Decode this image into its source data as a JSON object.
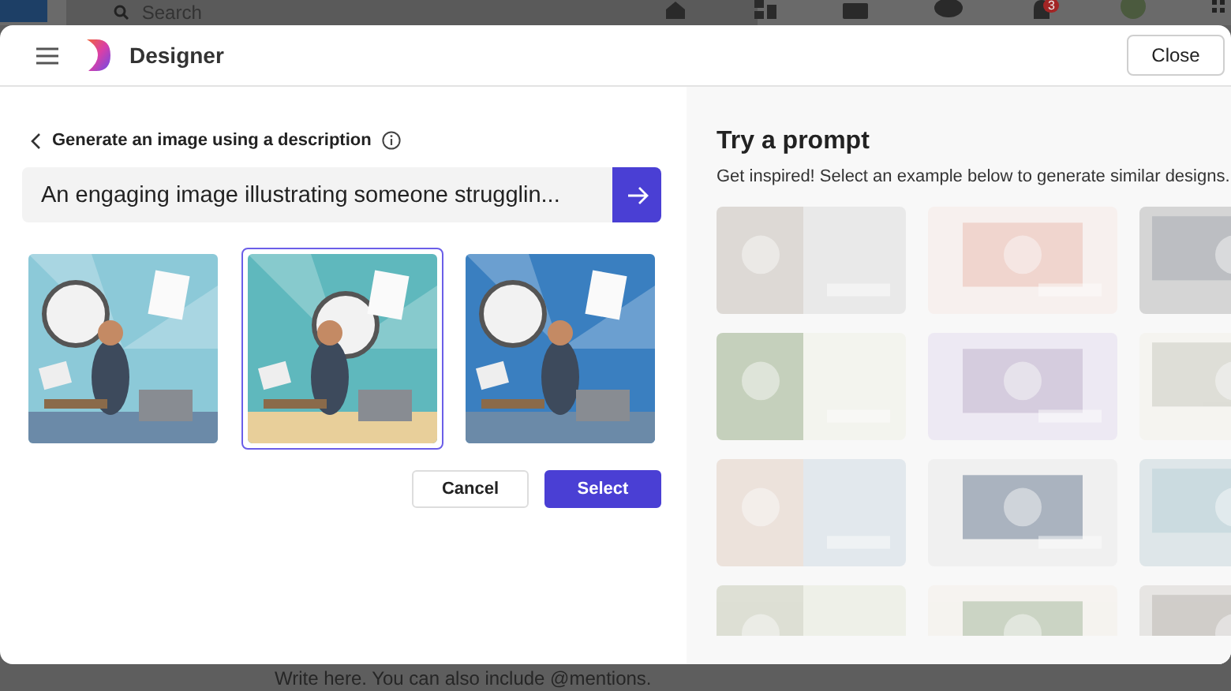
{
  "background": {
    "search": {
      "placeholder": "Search"
    },
    "notification_badge": "3",
    "composer": {
      "placeholder": "Write here. You can also include @mentions."
    }
  },
  "header": {
    "title": "Designer",
    "close_button": "Close"
  },
  "generator": {
    "back_label": "Generate an image using a description",
    "prompt": "An engaging image illustrating someone strugglin...",
    "results": [
      {
        "kind": "picture",
        "selected": false
      },
      {
        "kind": "picture",
        "selected": true
      },
      {
        "kind": "picture",
        "selected": false
      }
    ],
    "buttons": [
      {
        "label": "Cancel",
        "kind": "secondary"
      },
      {
        "label": "Select",
        "kind": "primary"
      }
    ]
  },
  "prompts_panel": {
    "title": "Try a prompt",
    "subtitle": "Get inspired! Select an example below to generate similar designs.",
    "examples": [
      {
        "kind": "picture"
      },
      {
        "kind": "picture"
      },
      {
        "kind": "picture"
      },
      {
        "kind": "picture"
      },
      {
        "kind": "picture"
      },
      {
        "kind": "picture"
      },
      {
        "kind": "picture"
      },
      {
        "kind": "picture"
      },
      {
        "kind": "picture"
      },
      {
        "kind": "picture"
      },
      {
        "kind": "picture"
      },
      {
        "kind": "picture"
      }
    ]
  }
}
